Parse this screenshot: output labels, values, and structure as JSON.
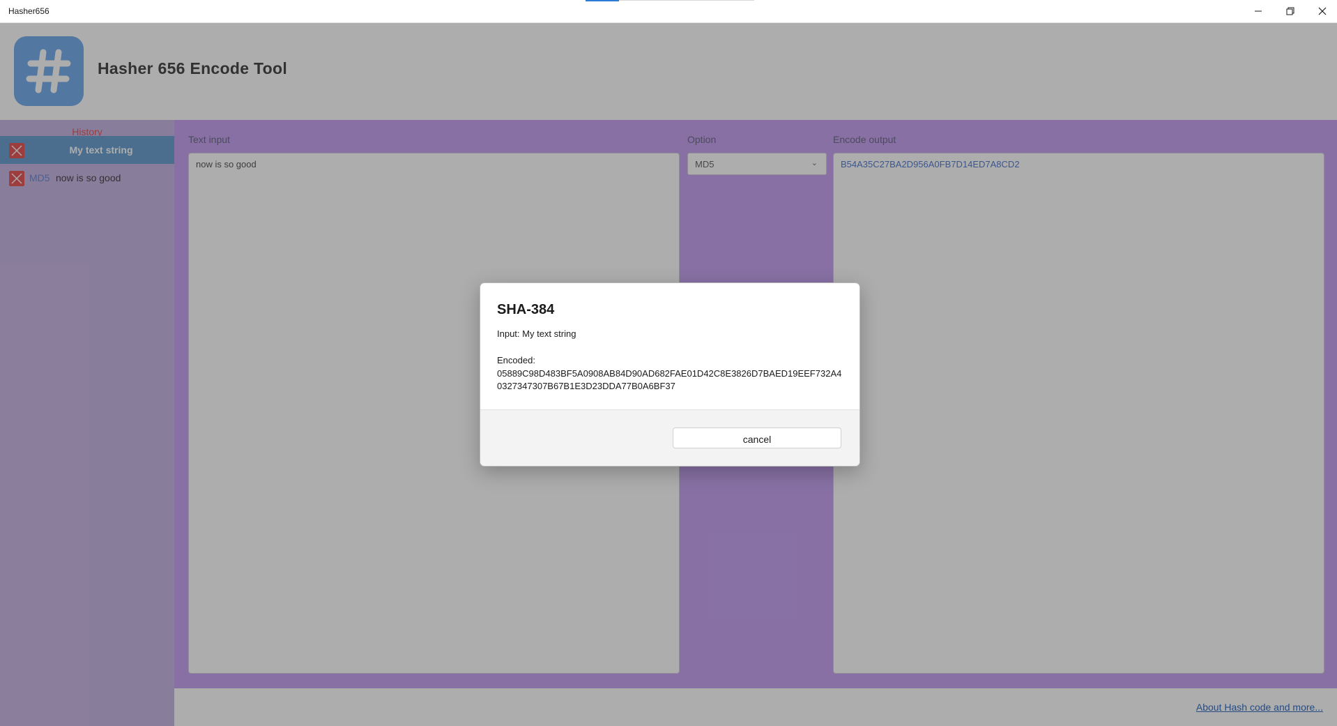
{
  "window": {
    "title": "Hasher656",
    "minimize_icon": "minimize-icon",
    "maximize_icon": "restore-icon",
    "close_icon": "close-icon"
  },
  "header": {
    "logo_icon": "hash-icon",
    "title": "Hasher 656 Encode Tool"
  },
  "sidebar": {
    "heading": "History",
    "items": [
      {
        "algo": "",
        "text": "My text string",
        "selected": true
      },
      {
        "algo": "MD5",
        "text": "now is so good",
        "selected": false
      }
    ]
  },
  "main": {
    "input_label": "Text input",
    "input_value": "now is so good",
    "option_label": "Option",
    "option_value": "MD5",
    "output_label": "Encode output",
    "output_value": "B54A35C27BA2D956A0FB7D14ED7A8CD2"
  },
  "footer": {
    "link": "About Hash code and more..."
  },
  "dialog": {
    "title": "SHA-384",
    "input_line": "Input: My text string",
    "encoded_label": "Encoded:",
    "encoded_value": "05889C98D483BF5A0908AB84D90AD682FAE01D42C8E3826D7BAED19EEF732A40327347307B67B1E3D23DDA77B0A6BF37",
    "cancel_label": "cancel"
  },
  "colors": {
    "accent_blue": "#2e7bd6",
    "sidebar_bg": "#cbb9e6",
    "main_bg": "#c9a6f2",
    "selected_item": "#6fa2d2",
    "delete_red": "#e85a5a",
    "logo_bg": "#7ab0ee"
  }
}
